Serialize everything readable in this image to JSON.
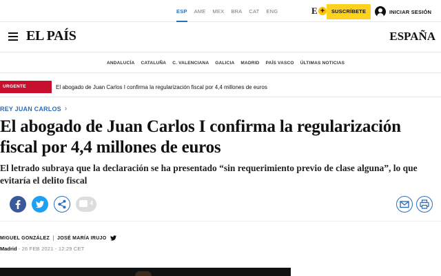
{
  "topbar": {
    "editions": [
      {
        "label": "ESP",
        "active": true
      },
      {
        "label": "AME",
        "active": false
      },
      {
        "label": "MEX",
        "active": false
      },
      {
        "label": "BRA",
        "active": false
      },
      {
        "label": "CAT",
        "active": false
      },
      {
        "label": "ENG",
        "active": false
      }
    ],
    "eplus_letter": "E",
    "eplus_symbol": "+",
    "subscribe_label": "SUSCRÍBETE",
    "login_label": "INICIAR SESIÓN"
  },
  "masthead": {
    "logo": "EL PAÍS",
    "section": "ESPAÑA"
  },
  "regions": [
    "ANDALUCÍA",
    "CATALUÑA",
    "C. VALENCIANA",
    "GALICIA",
    "MADRID",
    "PAÍS VASCO",
    "ÚLTIMAS NOTICIAS"
  ],
  "breaking": {
    "badge": "URGENTE",
    "text": "El abogado de Juan Carlos I confirma la regularización fiscal por 4,4 millones de euros"
  },
  "article": {
    "kicker": "REY JUAN CARLOS",
    "headline": "El abogado de Juan Carlos I confirma la regularización fiscal por 4,4 millones de euros",
    "subtitle": "El letrado subraya que la declaración se ha presentado “sin requerimiento previo de clase alguna”, lo que evitaría el delito fiscal",
    "comment_count": "4",
    "authors": [
      "MIGUEL GONZÁLEZ",
      "JOSÉ MARÍA IRUJO"
    ],
    "place": "Madrid",
    "date": "- 26 FEB 2021 - 12:29 CET"
  },
  "colors": {
    "accent": "#2a6ebb",
    "urgent": "#c8102e",
    "subscribe": "#ffd21f",
    "facebook": "#3b5998",
    "twitter": "#1da1f2"
  },
  "icons": [
    "hamburger-icon",
    "user-icon",
    "chevron-right-icon",
    "facebook-icon",
    "twitter-icon",
    "share-icon",
    "comment-icon",
    "mail-icon",
    "print-icon"
  ]
}
